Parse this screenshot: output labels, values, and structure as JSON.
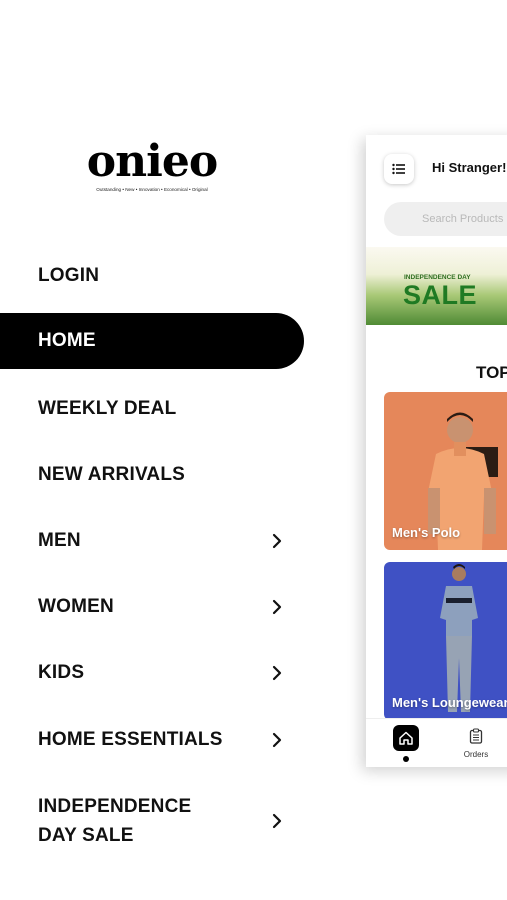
{
  "brand": {
    "logo_text": "onieo",
    "tagline": "Outstanding • New • Innovation • Economical • Original"
  },
  "menu": [
    {
      "label": "LOGIN",
      "chevron": false,
      "active": false
    },
    {
      "label": "HOME",
      "chevron": false,
      "active": true
    },
    {
      "label": "WEEKLY DEAL",
      "chevron": false,
      "active": false
    },
    {
      "label": "NEW ARRIVALS",
      "chevron": false,
      "active": false
    },
    {
      "label": "MEN",
      "chevron": true,
      "active": false
    },
    {
      "label": "WOMEN",
      "chevron": true,
      "active": false
    },
    {
      "label": "KIDS",
      "chevron": true,
      "active": false
    },
    {
      "label": "HOME ESSENTIALS",
      "chevron": true,
      "active": false
    },
    {
      "label": "INDEPENDENCE DAY SALE",
      "chevron": true,
      "active": false
    }
  ],
  "preview": {
    "greeting": "Hi Stranger!",
    "search_placeholder": "Search Products",
    "banner_small": "INDEPENDENCE DAY",
    "banner_big": "SALE",
    "section_title": "TOP",
    "cards": [
      {
        "caption": "Men's Polo",
        "color": "#e5875a"
      },
      {
        "caption": "Men's Loungewear",
        "color": "#3f51c4"
      }
    ],
    "nav": {
      "orders_label": "Orders"
    }
  },
  "colors": {
    "active_bg": "#000000",
    "banner_green": "#1f7a23"
  }
}
